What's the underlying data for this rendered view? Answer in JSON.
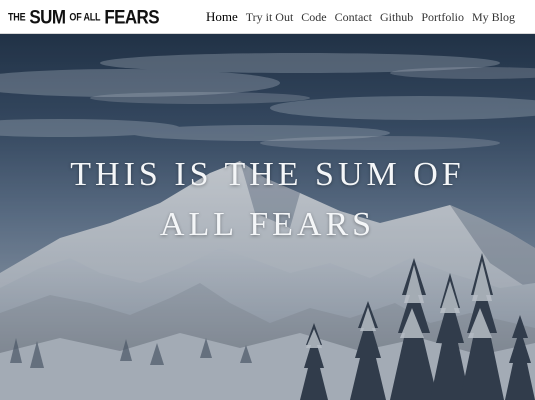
{
  "brand": {
    "part1": "THE",
    "part2": "SUM",
    "part3": "OF ALL",
    "part4": "FEARS"
  },
  "nav": {
    "items": [
      {
        "label": "Home",
        "active": true
      },
      {
        "label": "Try it Out",
        "active": false
      },
      {
        "label": "Code",
        "active": false
      },
      {
        "label": "Contact",
        "active": false
      },
      {
        "label": "Github",
        "active": false
      },
      {
        "label": "Portfolio",
        "active": false
      },
      {
        "label": "My Blog",
        "active": false
      }
    ]
  },
  "hero": {
    "title_line1": "This is the Sum of",
    "title_line2": "All Fears",
    "background": "snowy-mountain-photo"
  },
  "colors": {
    "sky_top": "#2a3b50",
    "sky_mid": "#6d8098",
    "snow": "#d6dbe1",
    "text": "#f4f6f8"
  }
}
